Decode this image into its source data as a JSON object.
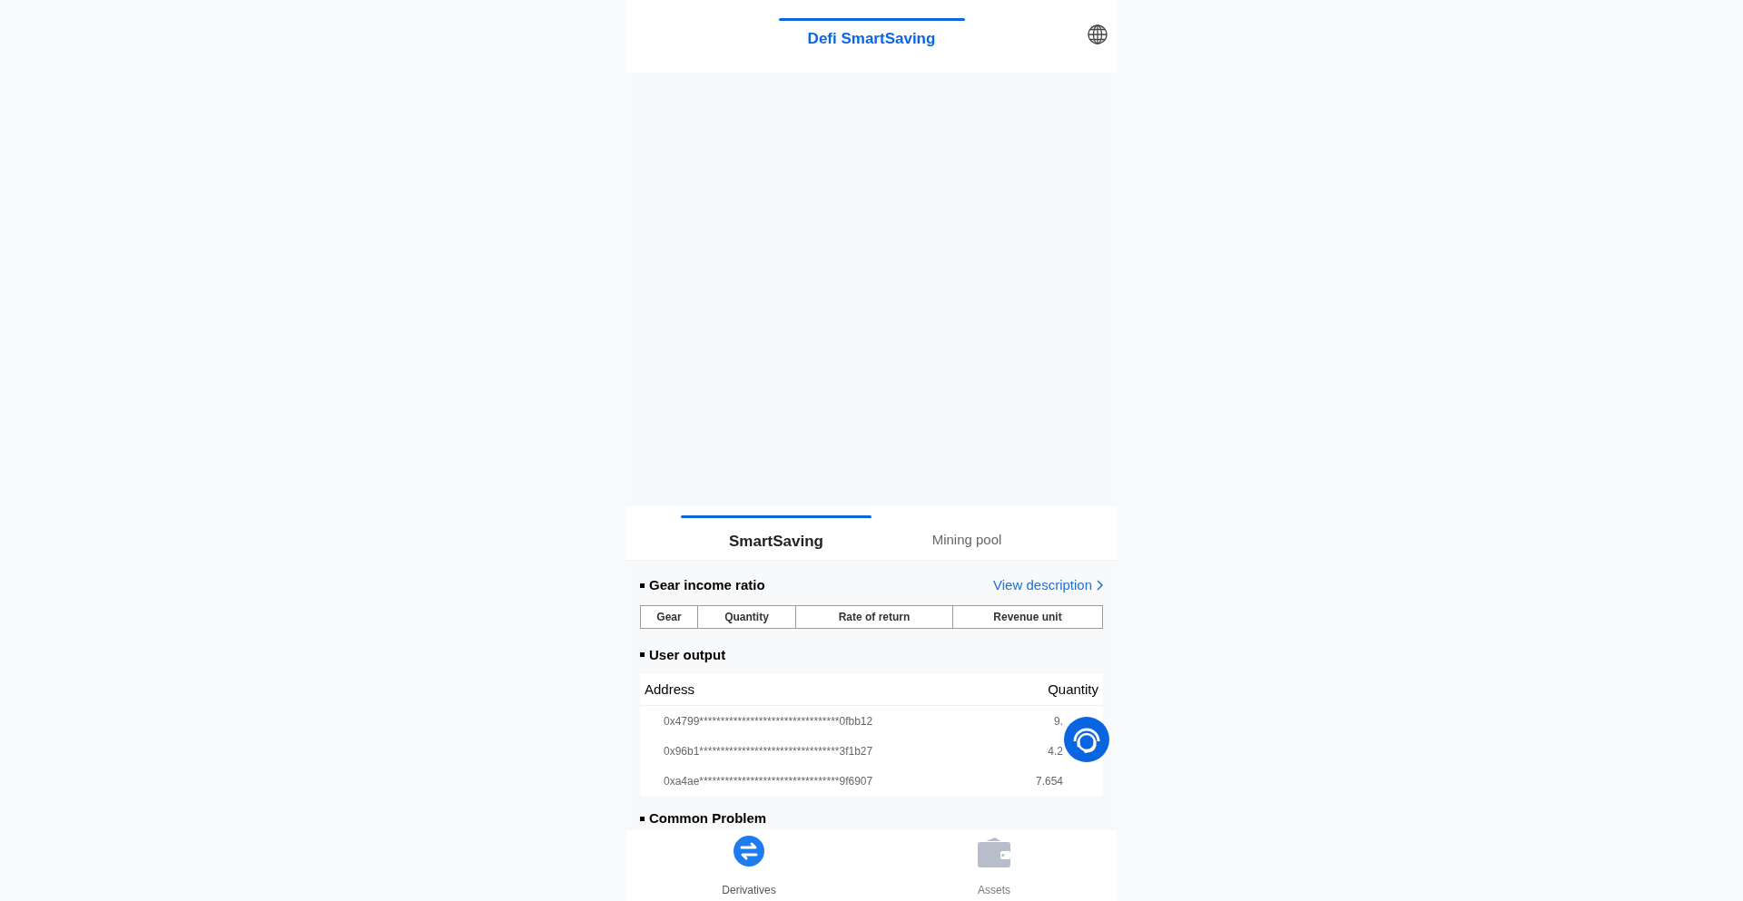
{
  "header": {
    "title": "Defi SmartSaving"
  },
  "tabs": [
    {
      "label": "SmartSaving",
      "selected": true
    },
    {
      "label": "Mining pool",
      "selected": false
    }
  ],
  "gear_section": {
    "title": "Gear income ratio",
    "link": "View description",
    "columns": [
      "Gear",
      "Quantity",
      "Rate of return",
      "Revenue unit"
    ]
  },
  "output_section": {
    "title": "User output",
    "columns": [
      "Address",
      "Quantity"
    ],
    "rows": [
      {
        "address": "0x4799*********************************0fbb12",
        "quantity": "9."
      },
      {
        "address": "0x96b1*********************************3f1b27",
        "quantity": "4.2"
      },
      {
        "address": "0xa4ae*********************************9f6907",
        "quantity": "7.654"
      }
    ]
  },
  "problem_section": {
    "title": "Common Problem"
  },
  "bottom_nav": [
    {
      "kind": "exchange",
      "label": "Derivatives",
      "selected": true
    },
    {
      "kind": "wallet",
      "label": "Assets",
      "selected": false
    }
  ]
}
